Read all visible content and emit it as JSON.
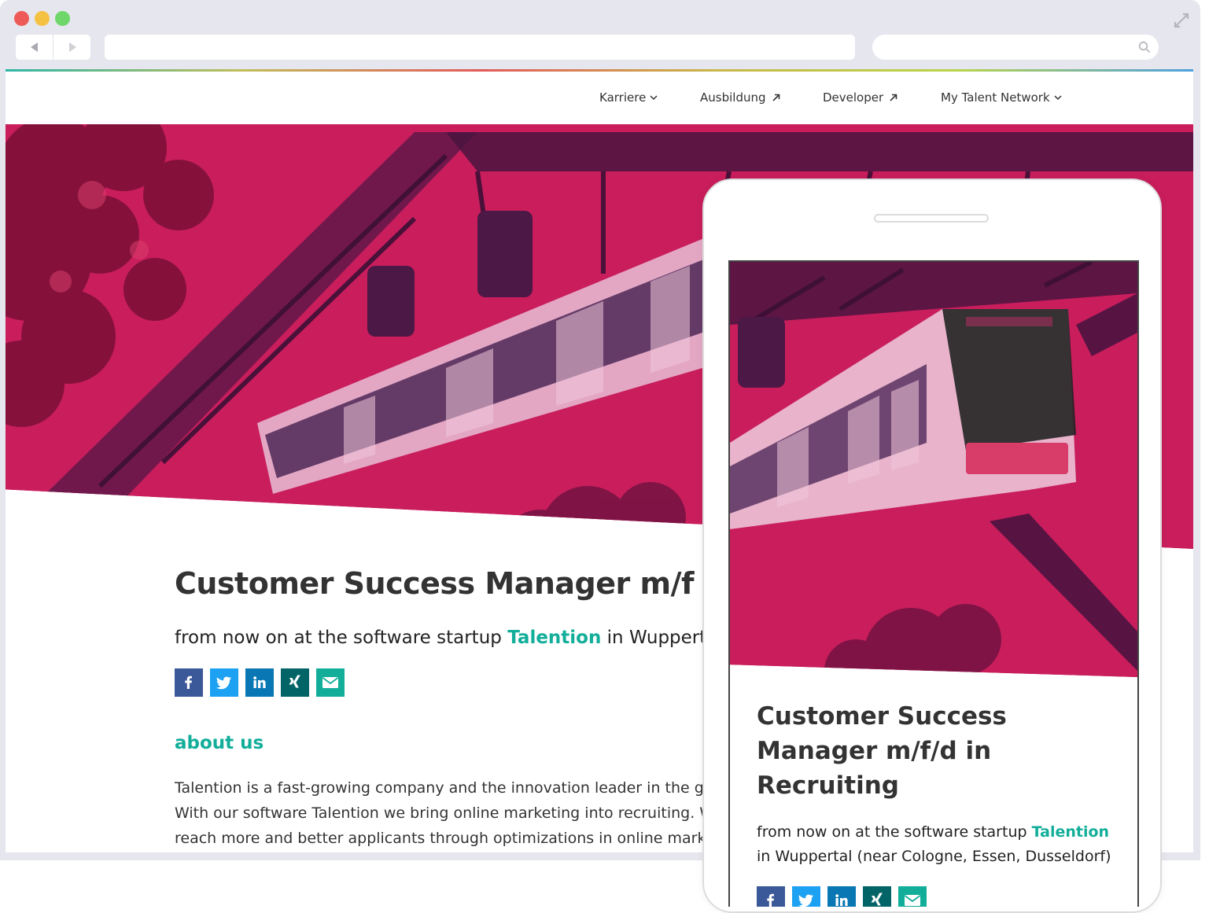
{
  "nav": {
    "items": [
      {
        "label": "Karriere",
        "icon": "chevron-down-icon"
      },
      {
        "label": "Ausbildung",
        "icon": "arrow-up-right-icon"
      },
      {
        "label": "Developer",
        "icon": "arrow-up-right-icon"
      },
      {
        "label": "My Talent Network",
        "icon": "chevron-down-icon"
      }
    ]
  },
  "job": {
    "title_desktop": "Customer Success Manager m/f",
    "title_mobile": "Customer Success Manager m/f/d in Recruiting",
    "subtitle_prefix": "from now on at the software startup",
    "company": "Talention",
    "subtitle_suffix_desktop": "in Wuppertal",
    "subtitle_suffix_mobile": "in Wuppertal (near Cologne, Essen, Dusseldorf)"
  },
  "share": [
    "facebook-icon",
    "twitter-icon",
    "linkedin-icon",
    "xing-icon",
    "email-icon"
  ],
  "about": {
    "heading": "about us",
    "lines": [
      "Talention is a fast-growing company and the innovation leader in the gro",
      "With our software Talention we bring online marketing into recruiting. We",
      "reach more and better applicants through optimizations in online market"
    ]
  },
  "colors": {
    "accent": "#12ae9a",
    "hero_tint": "#c41c5a",
    "facebook": "#3b5998",
    "twitter": "#1da1f2",
    "linkedin": "#0a77b5",
    "xing": "#026466"
  }
}
